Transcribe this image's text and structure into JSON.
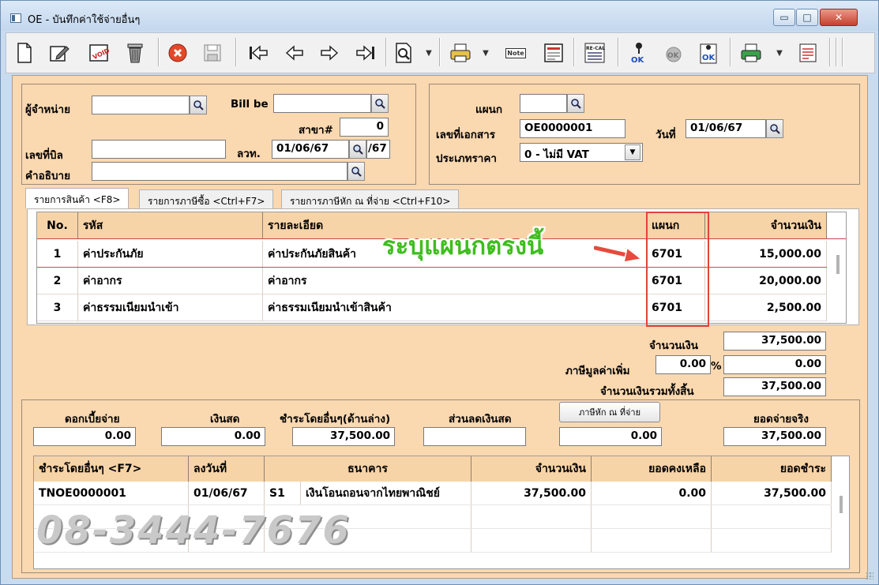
{
  "window": {
    "title": "OE - บันทึกค่าใช้จ่ายอื่นๆ",
    "min_glyph": "▭",
    "max_glyph": "□",
    "close_glyph": "✕"
  },
  "toolbar": {
    "icons": [
      "new-icon",
      "edit-icon",
      "void-icon",
      "delete-icon",
      "cancel-icon",
      "save-icon",
      "first-icon",
      "prev-icon",
      "next-icon",
      "last-icon",
      "search-icon",
      "print-icon",
      "note-icon",
      "form-icon",
      "recalc-icon",
      "approve-icon",
      "unapprove-icon",
      "approve-all-icon",
      "export-icon",
      "report-icon"
    ],
    "note_label": "Note",
    "recalc_label": "RE-CAL",
    "ok_label": "OK"
  },
  "header": {
    "vendor_label": "ผู้จำหน่าย",
    "vendor_value": "",
    "billbe_label": "Bill be",
    "billbe_value": "",
    "branch_label": "สาขา#",
    "branch_value": "0",
    "billno_label": "เลขที่บิล",
    "billno_value": "",
    "ltd_label": "ลวท.",
    "ltd_value": "01/06/67",
    "ltd_suffix": "/67",
    "desc_label": "คำอธิบาย",
    "desc_value": "",
    "dept_label": "แผนก",
    "dept_value": "",
    "docno_label": "เลขที่เอกสาร",
    "docno_value": "OE0000001",
    "date_label": "วันที่",
    "date_value": "01/06/67",
    "pricetype_label": "ประเภทราคา",
    "pricetype_value": "0 - ไม่มี VAT"
  },
  "tabs": [
    {
      "label": "รายการสินค้า <F8>"
    },
    {
      "label": "รายการภาษีซื้อ <Ctrl+F7>"
    },
    {
      "label": "รายการภาษีหัก ณ ที่จ่าย <Ctrl+F10>"
    }
  ],
  "items_table": {
    "headers": [
      "No.",
      "รหัส",
      "รายละเอียด",
      "แผนก",
      "จำนวนเงิน"
    ],
    "rows": [
      {
        "no": "1",
        "code": "ค่าประกันภัย",
        "detail": "ค่าประกันภัยสินค้า",
        "dept": "6701",
        "amount": "15,000.00"
      },
      {
        "no": "2",
        "code": "ค่าอากร",
        "detail": "ค่าอากร",
        "dept": "6701",
        "amount": "20,000.00"
      },
      {
        "no": "3",
        "code": "ค่าธรรมเนียมนำเข้า",
        "detail": "ค่าธรรมเนียมนำเข้าสินค้า",
        "dept": "6701",
        "amount": "2,500.00"
      }
    ]
  },
  "annotation": {
    "callout": "ระบุแผนกตรงนี้"
  },
  "totals": {
    "amount_label": "จำนวนเงิน",
    "amount_value": "37,500.00",
    "vat_label": "ภาษีมูลค่าเพิ่ม",
    "vat_rate": "0.00",
    "vat_pct": "%",
    "vat_value": "0.00",
    "grand_label": "จำนวนเงินรวมทั้งสิ้น",
    "grand_value": "37,500.00"
  },
  "payment": {
    "interest_label": "ดอกเบี้ยจ่าย",
    "interest_value": "0.00",
    "cash_label": "เงินสด",
    "cash_value": "0.00",
    "other_label": "ชำระโดยอื่นๆ(ด้านล่าง)",
    "other_value": "37,500.00",
    "discount_label": "ส่วนลดเงินสด",
    "discount_value": "",
    "wht_button": "ภาษีหัก ณ ที่จ่าย",
    "wht_value": "0.00",
    "actual_label": "ยอดจ่ายจริง",
    "actual_value": "37,500.00"
  },
  "pay_table": {
    "headers": [
      "ชำระโดยอื่นๆ <F7>",
      "ลงวันที่",
      "ธนาคาร",
      "จำนวนเงิน",
      "ยอดคงเหลือ",
      "ยอดชำระ"
    ],
    "rows": [
      {
        "ref": "TNOE0000001",
        "date": "01/06/67",
        "bank_code": "S1",
        "bank_name": "เงินโอนถอนจากไทยพาณิชย์",
        "amount": "37,500.00",
        "balance": "0.00",
        "paid": "37,500.00"
      }
    ]
  },
  "watermark": "08-3444-7676"
}
